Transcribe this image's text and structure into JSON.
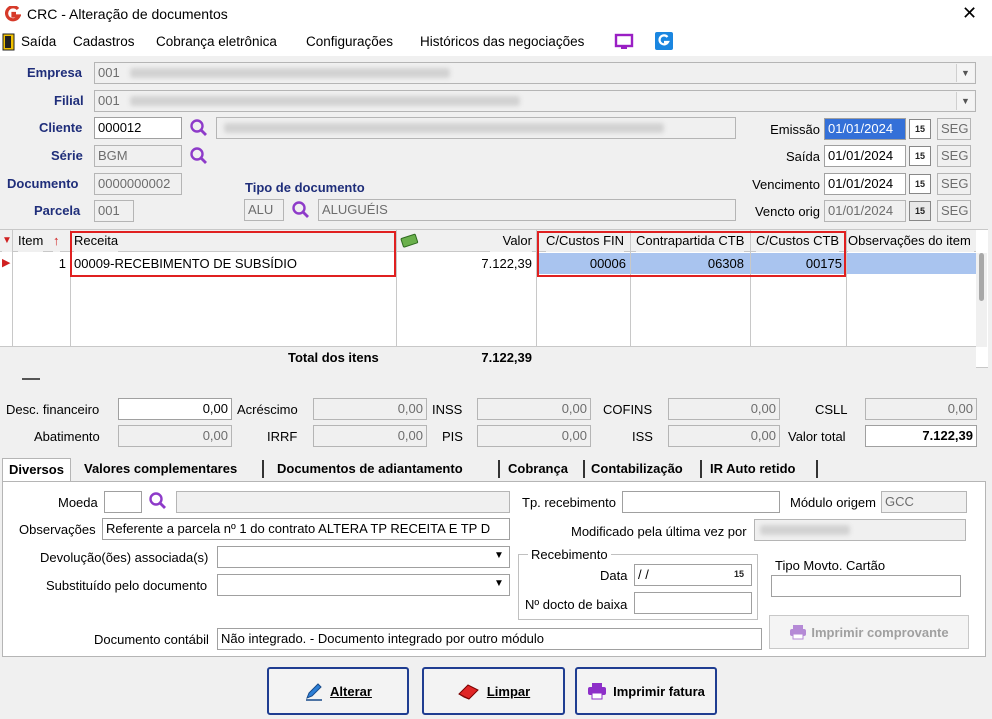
{
  "window": {
    "title": "CRC - Alteração de documentos"
  },
  "menu": {
    "items": [
      "Saída",
      "Cadastros",
      "Cobrança eletrônica",
      "Configurações",
      "Históricos das negociações"
    ]
  },
  "header": {
    "empresa_label": "Empresa",
    "empresa_code": "001",
    "filial_label": "Filial",
    "filial_code": "001",
    "cliente_label": "Cliente",
    "cliente_code": "000012",
    "serie_label": "Série",
    "serie_value": "BGM",
    "documento_label": "Documento",
    "documento_value": "0000000002",
    "parcela_label": "Parcela",
    "parcela_value": "001",
    "tipo_doc_label": "Tipo de documento",
    "tipo_doc_code": "ALU",
    "tipo_doc_desc": "ALUGUÉIS",
    "emissao_label": "Emissão",
    "emissao_date": "01/01/2024",
    "emissao_day": "SEG",
    "saida_label": "Saída",
    "saida_date": "01/01/2024",
    "saida_day": "SEG",
    "vencimento_label": "Vencimento",
    "vencimento_date": "01/01/2024",
    "vencimento_day": "SEG",
    "vencto_orig_label": "Vencto orig",
    "vencto_orig_date": "01/01/2024",
    "vencto_orig_day": "SEG"
  },
  "grid": {
    "columns": {
      "item": "Item",
      "receita": "Receita",
      "valor": "Valor",
      "ccfin": "C/Custos FIN",
      "contrapartida": "Contrapartida CTB",
      "ccctb": "C/Custos CTB",
      "obs": "Observações do item"
    },
    "rows": [
      {
        "item": "1",
        "receita": "00009-RECEBIMENTO DE SUBSÍDIO",
        "valor": "7.122,39",
        "ccfin": "00006",
        "contrapartida": "06308",
        "ccctb": "00175"
      }
    ],
    "total_label": "Total dos itens",
    "total_value": "7.122,39"
  },
  "totals": {
    "desc_financeiro_label": "Desc. financeiro",
    "desc_financeiro": "0,00",
    "acrescimo_label": "Acréscimo",
    "acrescimo": "0,00",
    "inss_label": "INSS",
    "inss": "0,00",
    "cofins_label": "COFINS",
    "cofins": "0,00",
    "csll_label": "CSLL",
    "csll": "0,00",
    "abatimento_label": "Abatimento",
    "abatimento": "0,00",
    "irrf_label": "IRRF",
    "irrf": "0,00",
    "pis_label": "PIS",
    "pis": "0,00",
    "iss_label": "ISS",
    "iss": "0,00",
    "valor_total_label": "Valor total",
    "valor_total": "7.122,39"
  },
  "tabs": [
    "Diversos",
    "Valores complementares",
    "Documentos de adiantamento",
    "Cobrança",
    "Contabilização",
    "IR Auto retido"
  ],
  "diversos": {
    "moeda_label": "Moeda",
    "moeda_value": "",
    "observacoes_label": "Observações",
    "observacoes_value": "Referente a parcela nº 1 do contrato ALTERA TP RECEITA E TP D",
    "devolucoes_label": "Devolução(ões) associada(s)",
    "substituido_label": "Substituído pelo documento",
    "tp_recebimento_label": "Tp. recebimento",
    "tp_recebimento_value": "",
    "modulo_origem_label": "Módulo origem",
    "modulo_origem_value": "GCC",
    "modificado_label": "Modificado pela última vez por",
    "recebimento_group": "Recebimento",
    "data_label": "Data",
    "data_value": " /  /",
    "nro_docto_label": "Nº docto de baixa",
    "nro_docto_value": "",
    "tipo_movto_label": "Tipo Movto. Cartão",
    "tipo_movto_value": "",
    "imprimir_comprovante": "Imprimir comprovante",
    "documento_contabil_label": "Documento contábil",
    "documento_contabil_value": "Não integrado.  - Documento integrado por outro módulo"
  },
  "buttons": {
    "alterar": "Alterar",
    "limpar": "Limpar",
    "imprimir_fatura": "Imprimir fatura"
  },
  "colors": {
    "accent": "#1f3d91",
    "highlight": "#e02020",
    "selection": "#3470d8"
  }
}
